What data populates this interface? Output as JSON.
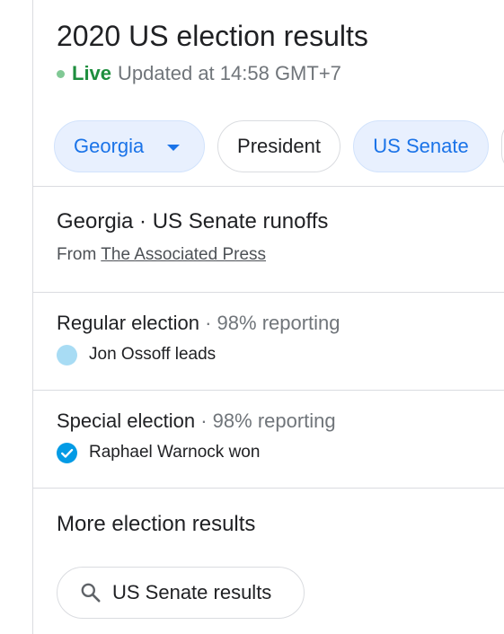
{
  "header": {
    "title": "2020 US election results",
    "live_label": "Live",
    "updated_text": "Updated at 14:58 GMT+7"
  },
  "chips": {
    "georgia": "Georgia",
    "president": "President",
    "us_senate": "US Senate"
  },
  "runoffs": {
    "title": "Georgia · US Senate runoffs",
    "source_prefix": "From",
    "source_link": "The Associated Press"
  },
  "regular": {
    "title": "Regular election",
    "separator": " · ",
    "reporting": "98% reporting",
    "result": "Jon Ossoff leads"
  },
  "special": {
    "title": "Special election",
    "separator": " · ",
    "reporting": "98% reporting",
    "result": "Raphael Warnock won"
  },
  "more": {
    "title": "More election results",
    "search_label": "US Senate results"
  },
  "icons": {
    "caret": "chevron-down-icon",
    "leads": "leads-dot-icon",
    "won": "check-circle-icon",
    "search": "search-icon"
  },
  "colors": {
    "live_green": "#1e8e3e",
    "live_dot": "#81c995",
    "accent_blue": "#1a73e8",
    "chip_selected_bg": "#e8f0fe",
    "lead_dot": "#a8dcf4",
    "won_check": "#039be5"
  }
}
